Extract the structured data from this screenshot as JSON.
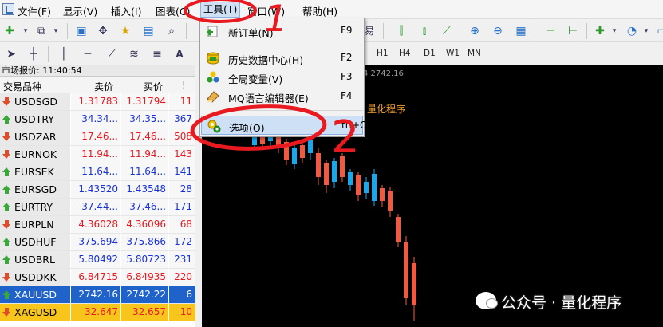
{
  "menubar": {
    "items": [
      "文件(F)",
      "显示(V)",
      "插入(I)",
      "图表(C)",
      "工具(T)",
      "窗口(W)",
      "帮助(H)"
    ]
  },
  "toolbar": {
    "timeframes": [
      "H1",
      "H4",
      "D1",
      "W1",
      "MN"
    ],
    "partial_label": "易"
  },
  "market_watch": {
    "title": "市场报价: 11:40:54",
    "columns": {
      "symbol": "交易品种",
      "bid": "卖价",
      "ask": "买价",
      "spread": "!"
    },
    "rows": [
      {
        "symbol": "USDSGD",
        "bid": "1.31783",
        "ask": "1.31794",
        "spread": "11",
        "dir": "down",
        "color": "red"
      },
      {
        "symbol": "USDTRY",
        "bid": "34.34...",
        "ask": "34.35...",
        "spread": "367",
        "dir": "up",
        "color": "blue"
      },
      {
        "symbol": "USDZAR",
        "bid": "17.46...",
        "ask": "17.46...",
        "spread": "508",
        "dir": "down",
        "color": "red"
      },
      {
        "symbol": "EURNOK",
        "bid": "11.94...",
        "ask": "11.94...",
        "spread": "143",
        "dir": "down",
        "color": "red"
      },
      {
        "symbol": "EURSEK",
        "bid": "11.64...",
        "ask": "11.64...",
        "spread": "141",
        "dir": "up",
        "color": "blue"
      },
      {
        "symbol": "EURSGD",
        "bid": "1.43520",
        "ask": "1.43548",
        "spread": "28",
        "dir": "up",
        "color": "blue"
      },
      {
        "symbol": "EURTRY",
        "bid": "37.44...",
        "ask": "37.46...",
        "spread": "171",
        "dir": "up",
        "color": "blue"
      },
      {
        "symbol": "EURPLN",
        "bid": "4.36028",
        "ask": "4.36096",
        "spread": "68",
        "dir": "down",
        "color": "red"
      },
      {
        "symbol": "USDHUF",
        "bid": "375.694",
        "ask": "375.866",
        "spread": "172",
        "dir": "up",
        "color": "blue"
      },
      {
        "symbol": "USDBRL",
        "bid": "5.80492",
        "ask": "5.80723",
        "spread": "231",
        "dir": "up",
        "color": "blue"
      },
      {
        "symbol": "USDDKK",
        "bid": "6.84715",
        "ask": "6.84935",
        "spread": "220",
        "dir": "down",
        "color": "red"
      },
      {
        "symbol": "XAUUSD",
        "bid": "2742.16",
        "ask": "2742.22",
        "spread": "6",
        "dir": "up",
        "color": "selected"
      },
      {
        "symbol": "XAGUSD",
        "bid": "32.647",
        "ask": "32.657",
        "spread": "10",
        "dir": "down",
        "color": "gold"
      }
    ]
  },
  "chart": {
    "info": "4 2742.16",
    "overlay_text": "量化程序"
  },
  "tools_menu": {
    "items": [
      {
        "label": "新订单(N)",
        "shortcut": "F9",
        "icon": "new-order-icon"
      },
      {
        "label": "历史数据中心(H)",
        "shortcut": "F2",
        "icon": "history-center-icon"
      },
      {
        "label": "全局变量(V)",
        "shortcut": "F3",
        "icon": "global-variables-icon"
      },
      {
        "label": "MQ语言编辑器(E)",
        "shortcut": "F4",
        "icon": "editor-icon"
      },
      {
        "label": "选项(O)",
        "shortcut": "trl+O",
        "icon": "options-icon"
      }
    ]
  },
  "watermark": {
    "text": "公众号 · 量化程序"
  },
  "annotations": {
    "step1": "1",
    "step2": "2"
  },
  "colors": {
    "selected_row": "#1f62c9",
    "gold_row": "#f7c51c",
    "bull": "#ef5b42",
    "bear": "#1ea7e8",
    "annotation": "#e8191f"
  }
}
